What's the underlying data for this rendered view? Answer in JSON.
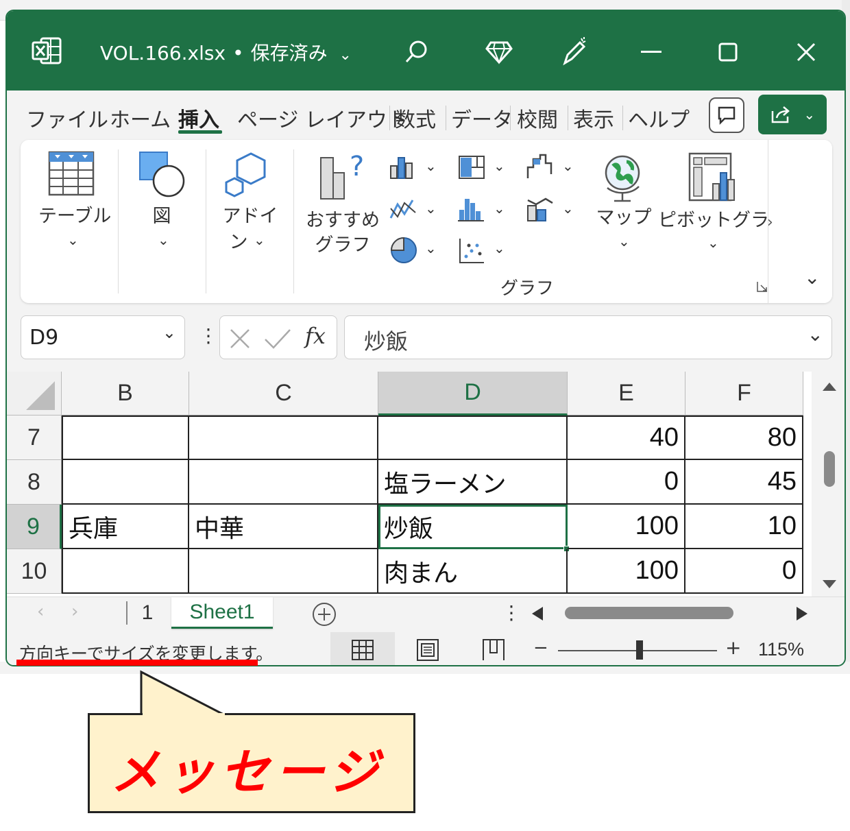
{
  "window": {
    "title_file": "VOL.166.xlsx",
    "title_status": "保存済み",
    "accent_color": "#1e7145"
  },
  "tabs": [
    "ファイル",
    "ホーム",
    "挿入",
    "ページ レイアウト",
    "数式",
    "データ",
    "校閲",
    "表示",
    "ヘルプ"
  ],
  "active_tab": "挿入",
  "ribbon": {
    "table_label": "テーブル",
    "figure_label": "図",
    "addin_label_1": "アドイ",
    "addin_label_2": "ン",
    "recommended_label_1": "おすすめ",
    "recommended_label_2": "グラフ",
    "map_label": "マップ",
    "pivotchart_label": "ピボットグラフ",
    "group_chart_label": "グラフ"
  },
  "formula_bar": {
    "name_box": "D9",
    "fx_symbol": "fx",
    "formula": "炒飯"
  },
  "columns": [
    "B",
    "C",
    "D",
    "E",
    "F"
  ],
  "selected_column": "D",
  "rows": [
    {
      "num": "7",
      "B": "",
      "C": "",
      "D": "",
      "E": "40",
      "F": "80"
    },
    {
      "num": "8",
      "B": "",
      "C": "",
      "D": "塩ラーメン",
      "E": "0",
      "F": "45"
    },
    {
      "num": "9",
      "B": "兵庫",
      "C": "中華",
      "D": "炒飯",
      "E": "100",
      "F": "10"
    },
    {
      "num": "10",
      "B": "",
      "C": "",
      "D": "肉まん",
      "E": "100",
      "F": "0"
    }
  ],
  "sheets": {
    "sheet_1": "1",
    "sheet_active": "Sheet1"
  },
  "status": {
    "message": "方向キーでサイズを変更します。",
    "zoom": "115%",
    "zoom_minus": "−",
    "zoom_plus": "+"
  },
  "annotation": {
    "callout_text": "メッセージ",
    "callout_bg": "#fff2cc",
    "text_color": "#ff0000"
  }
}
